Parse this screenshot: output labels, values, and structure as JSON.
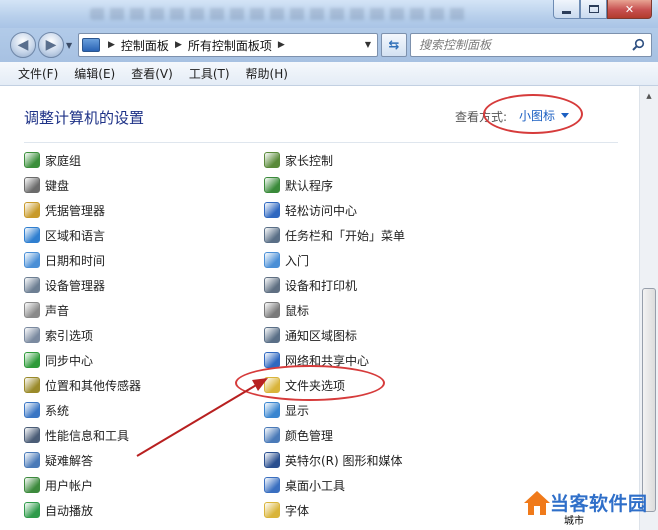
{
  "window": {
    "minimize": "—",
    "maximize": "□",
    "close": "✕"
  },
  "address_bar": {
    "crumbs": [
      "控制面板",
      "所有控制面板项"
    ]
  },
  "search": {
    "placeholder": "搜索控制面板"
  },
  "menu": [
    "文件(F)",
    "编辑(E)",
    "查看(V)",
    "工具(T)",
    "帮助(H)"
  ],
  "page": {
    "title": "调整计算机的设置",
    "view_label": "查看方式:",
    "view_value": "小图标"
  },
  "items_left": [
    {
      "label": "家庭组",
      "icon": "homegroup-icon",
      "color": "#3b8f3b"
    },
    {
      "label": "键盘",
      "icon": "keyboard-icon",
      "color": "#6b6b6b"
    },
    {
      "label": "凭据管理器",
      "icon": "credential-manager-icon",
      "color": "#c89a2a"
    },
    {
      "label": "区域和语言",
      "icon": "region-language-icon",
      "color": "#2f7fd0"
    },
    {
      "label": "日期和时间",
      "icon": "date-time-icon",
      "color": "#4a8fd6"
    },
    {
      "label": "设备管理器",
      "icon": "device-manager-icon",
      "color": "#6d7f93"
    },
    {
      "label": "声音",
      "icon": "sound-icon",
      "color": "#8a8a8a"
    },
    {
      "label": "索引选项",
      "icon": "indexing-options-icon",
      "color": "#7b8aa0"
    },
    {
      "label": "同步中心",
      "icon": "sync-center-icon",
      "color": "#2e9b3a"
    },
    {
      "label": "位置和其他传感器",
      "icon": "location-sensors-icon",
      "color": "#9a8a2a"
    },
    {
      "label": "系统",
      "icon": "system-icon",
      "color": "#3a76c4"
    },
    {
      "label": "性能信息和工具",
      "icon": "performance-icon",
      "color": "#4b5d77"
    },
    {
      "label": "疑难解答",
      "icon": "troubleshooting-icon",
      "color": "#4a7ab8"
    },
    {
      "label": "用户帐户",
      "icon": "user-accounts-icon",
      "color": "#3d8a3d"
    },
    {
      "label": "自动播放",
      "icon": "autoplay-icon",
      "color": "#2f9b4a"
    }
  ],
  "items_right": [
    {
      "label": "家长控制",
      "icon": "parental-controls-icon",
      "color": "#5a8a3a"
    },
    {
      "label": "默认程序",
      "icon": "default-programs-icon",
      "color": "#3a8a3a"
    },
    {
      "label": "轻松访问中心",
      "icon": "ease-of-access-icon",
      "color": "#2f68c0"
    },
    {
      "label": "任务栏和「开始」菜单",
      "icon": "taskbar-start-icon",
      "color": "#5a6f87"
    },
    {
      "label": "入门",
      "icon": "getting-started-icon",
      "color": "#4a8fd6"
    },
    {
      "label": "设备和打印机",
      "icon": "devices-printers-icon",
      "color": "#5f6f82"
    },
    {
      "label": "鼠标",
      "icon": "mouse-icon",
      "color": "#7a7a7a"
    },
    {
      "label": "通知区域图标",
      "icon": "notification-area-icon",
      "color": "#5a6f87"
    },
    {
      "label": "网络和共享中心",
      "icon": "network-sharing-icon",
      "color": "#2f68c0"
    },
    {
      "label": "文件夹选项",
      "icon": "folder-options-icon",
      "color": "#d9b43a"
    },
    {
      "label": "显示",
      "icon": "display-icon",
      "color": "#3a86d0"
    },
    {
      "label": "颜色管理",
      "icon": "color-management-icon",
      "color": "#4a7ab8"
    },
    {
      "label": "英特尔(R) 图形和媒体",
      "icon": "intel-graphics-icon",
      "color": "#2a4f8f"
    },
    {
      "label": "桌面小工具",
      "icon": "desktop-gadgets-icon",
      "color": "#3a6fc0"
    },
    {
      "label": "字体",
      "icon": "fonts-icon",
      "color": "#d9b43a"
    }
  ],
  "watermark": {
    "title": "当客软件园",
    "sub": "城市"
  },
  "colors": {
    "accent": "#1b5fc2",
    "title": "#1e3287",
    "annotation": "#d63b3b"
  }
}
